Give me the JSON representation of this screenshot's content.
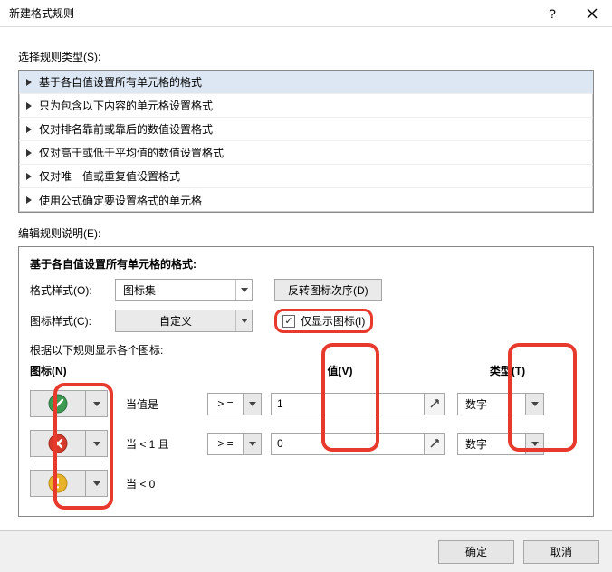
{
  "titlebar": {
    "title": "新建格式规则"
  },
  "sections": {
    "select_rule_type": "选择规则类型(S):",
    "edit_rule_desc": "编辑规则说明(E):"
  },
  "rule_types": [
    "基于各自值设置所有单元格的格式",
    "只为包含以下内容的单元格设置格式",
    "仅对排名靠前或靠后的数值设置格式",
    "仅对高于或低于平均值的数值设置格式",
    "仅对唯一值或重复值设置格式",
    "使用公式确定要设置格式的单元格"
  ],
  "panel": {
    "heading": "基于各自值设置所有单元格的格式:",
    "format_style_label": "格式样式(O):",
    "format_style_value": "图标集",
    "reverse_btn": "反转图标次序(D)",
    "icon_style_label": "图标样式(C):",
    "icon_style_value": "自定义",
    "show_icon_only": "仅显示图标(I)",
    "rule_hint": "根据以下规则显示各个图标:",
    "col_icon": "图标(N)",
    "col_value": "值(V)",
    "col_type": "类型(T)",
    "rows": [
      {
        "when": "当值是",
        "op": "> =",
        "value": "1",
        "type": "数字",
        "icon": "check"
      },
      {
        "when": "当 < 1 且",
        "op": "> =",
        "value": "0",
        "type": "数字",
        "icon": "cross"
      },
      {
        "when": "当 < 0",
        "op": "",
        "value": "",
        "type": "",
        "icon": "warn"
      }
    ]
  },
  "footer": {
    "ok": "确定",
    "cancel": "取消"
  }
}
